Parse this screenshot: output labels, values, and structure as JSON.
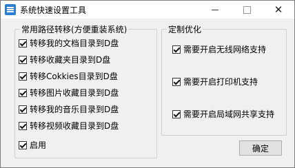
{
  "window": {
    "title": "系统快速设置工具",
    "min_glyph": "",
    "close_glyph": "✕"
  },
  "left_group": {
    "title": "常用路径转移(方便重装系统)",
    "items": [
      {
        "label": "转移我的文档目录到D盘",
        "checked": true
      },
      {
        "label": "转移收藏夹目录到D盘",
        "checked": true
      },
      {
        "label": "转移Cokkies目录到D盘",
        "checked": true
      },
      {
        "label": "转移图片收藏目录到D盘",
        "checked": true
      },
      {
        "label": "转移我的音乐目录到D盘",
        "checked": true
      },
      {
        "label": "转移视频收藏目录到D盘",
        "checked": true
      }
    ],
    "enable": {
      "label": "启用",
      "checked": true
    }
  },
  "right_group": {
    "title": "定制优化",
    "items": [
      {
        "label": "需要开启无线网络支持",
        "checked": true
      },
      {
        "label": "需要开启打印机支持",
        "checked": true
      },
      {
        "label": "需要开启局域网共享支持",
        "checked": true
      }
    ]
  },
  "buttons": {
    "ok": "确定"
  }
}
